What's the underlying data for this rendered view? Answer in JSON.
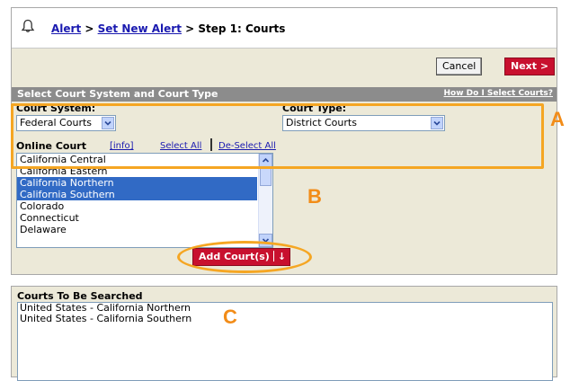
{
  "breadcrumb": {
    "alert": "Alert",
    "sep1": " > ",
    "set_new_alert": "Set New Alert",
    "sep2": " > ",
    "current": "Step 1: Courts"
  },
  "toolbar": {
    "cancel_label": "Cancel",
    "next_label": "Next >"
  },
  "section": {
    "title": "Select Court System and Court Type",
    "help_link": "How Do I Select Courts?"
  },
  "court_system": {
    "label": "Court System:",
    "value": "Federal Courts"
  },
  "court_type": {
    "label": "Court Type:",
    "value": "District Courts"
  },
  "online_court": {
    "label": "Online Court",
    "info_link": "[info]",
    "select_all": "Select All",
    "deselect_all": "De-Select All",
    "items": [
      {
        "label": "California Central",
        "selected": false
      },
      {
        "label": "California Eastern",
        "selected": false
      },
      {
        "label": "California Northern",
        "selected": true
      },
      {
        "label": "California Southern",
        "selected": true
      },
      {
        "label": "Colorado",
        "selected": false
      },
      {
        "label": "Connecticut",
        "selected": false
      },
      {
        "label": "Delaware",
        "selected": false
      }
    ],
    "add_button": "Add Court(s)",
    "add_arrow": "↓"
  },
  "searched": {
    "label": "Courts To Be Searched",
    "items": [
      "United States - California Northern",
      "United States - California Southern"
    ]
  },
  "annotations": {
    "a": "A",
    "b": "B",
    "c": "C",
    "color": "#f5a623"
  },
  "colors": {
    "accent_red": "#c8102e",
    "selection_blue": "#316ac5",
    "panel_bg": "#ece9d8",
    "link_blue": "#1a1ab0"
  },
  "icons": {
    "header": "bell-icon",
    "dropdown": "chevron-down-icon"
  }
}
